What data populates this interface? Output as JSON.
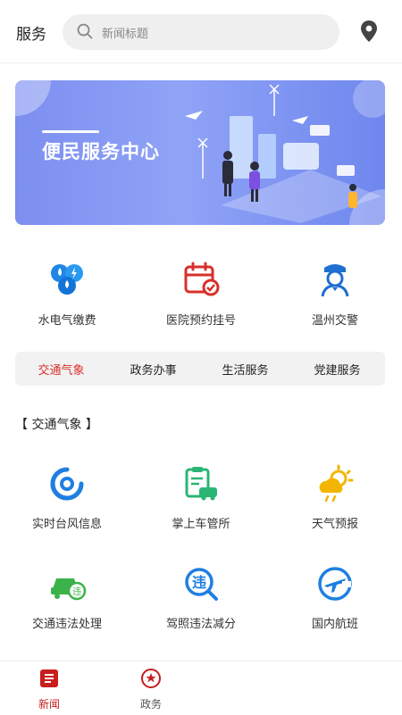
{
  "header": {
    "title": "服务",
    "search_placeholder": "新闻标题"
  },
  "banner": {
    "text": "便民服务中心"
  },
  "top_services": [
    {
      "label": "水电气缴费",
      "icon": "utility-icon"
    },
    {
      "label": "医院预约挂号",
      "icon": "calendar-check-icon"
    },
    {
      "label": "温州交警",
      "icon": "police-icon"
    }
  ],
  "tabs": [
    "交通气象",
    "政务办事",
    "生活服务",
    "党建服务"
  ],
  "section_title": "【 交通气象 】",
  "grid": [
    {
      "label": "实时台风信息",
      "icon": "typhoon-icon"
    },
    {
      "label": "掌上车管所",
      "icon": "clipboard-car-icon"
    },
    {
      "label": "天气预报",
      "icon": "weather-icon"
    },
    {
      "label": "交通违法处理",
      "icon": "car-violation-icon"
    },
    {
      "label": "驾照违法减分",
      "icon": "license-search-icon"
    },
    {
      "label": "国内航班",
      "icon": "airplane-icon"
    }
  ],
  "bottom_nav": [
    {
      "label": "新闻",
      "icon": "news-icon"
    },
    {
      "label": "政务",
      "icon": "government-icon"
    }
  ],
  "colors": {
    "active": "#d9302c",
    "blue": "#1f7fe0",
    "green": "#2bb574",
    "yellow": "#f2b600"
  }
}
